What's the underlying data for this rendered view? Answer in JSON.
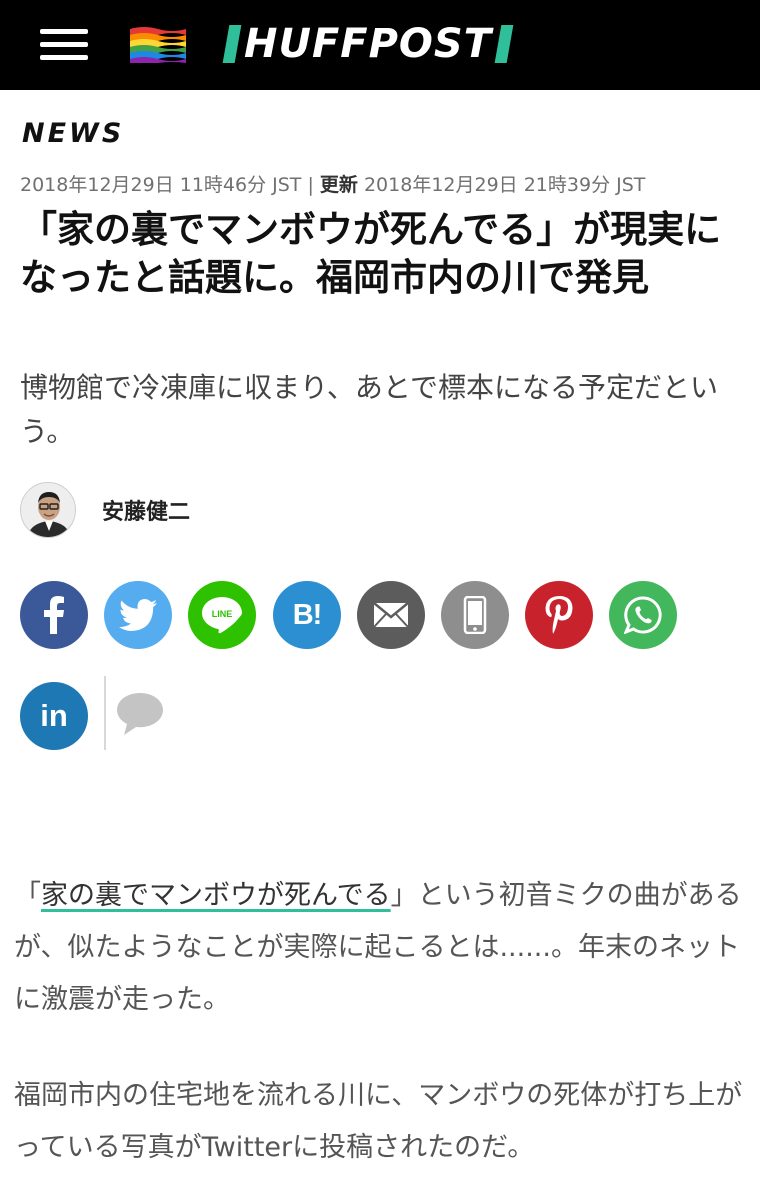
{
  "header": {
    "logo": "HUFFPOST",
    "menu_icon": "hamburger-menu-icon",
    "flag_icon": "rainbow-flag-icon",
    "accent": "#2fbf9b",
    "background": "#000000"
  },
  "article": {
    "section": "NEWS",
    "published": "2018年12月29日 11時46分 JST",
    "separator": " | ",
    "updated_label": "更新",
    "updated": "2018年12月29日 21時39分 JST",
    "headline": "「家の裏でマンボウが死んでる」が現実になったと話題に。福岡市内の川で発見",
    "subhead": "博物館で冷凍庫に収まり、あとで標本になる予定だという。",
    "author": "安藤健二"
  },
  "share": {
    "buttons": [
      {
        "name": "facebook",
        "icon": "facebook-icon",
        "color": "#3b5998"
      },
      {
        "name": "twitter",
        "icon": "twitter-icon",
        "color": "#55acee"
      },
      {
        "name": "line",
        "icon": "line-icon",
        "label": "LINE",
        "color": "#2dc100"
      },
      {
        "name": "hatena",
        "icon": "hatena-bookmark-icon",
        "label": "B!",
        "color": "#2b8fd1"
      },
      {
        "name": "email",
        "icon": "mail-icon",
        "color": "#5c5c5c"
      },
      {
        "name": "mobile",
        "icon": "mobile-phone-icon",
        "color": "#8e8e8e"
      },
      {
        "name": "pinterest",
        "icon": "pinterest-icon",
        "color": "#c8232c"
      },
      {
        "name": "whatsapp",
        "icon": "whatsapp-icon",
        "color": "#43b75b"
      },
      {
        "name": "linkedin",
        "icon": "linkedin-icon",
        "label": "in",
        "color": "#1e78b4"
      }
    ],
    "comment_icon": "comment-bubble-icon"
  },
  "body": {
    "p1_open": "「",
    "p1_link": "家の裏でマンボウが死んでる",
    "p1_rest": "」という初音ミクの曲があるが、似たようなことが実際に起こるとは......。年末のネットに激震が走った。",
    "p2": "福岡市内の住宅地を流れる川に、マンボウの死体が打ち上がっている写真がTwitterに投稿されたのだ。"
  }
}
